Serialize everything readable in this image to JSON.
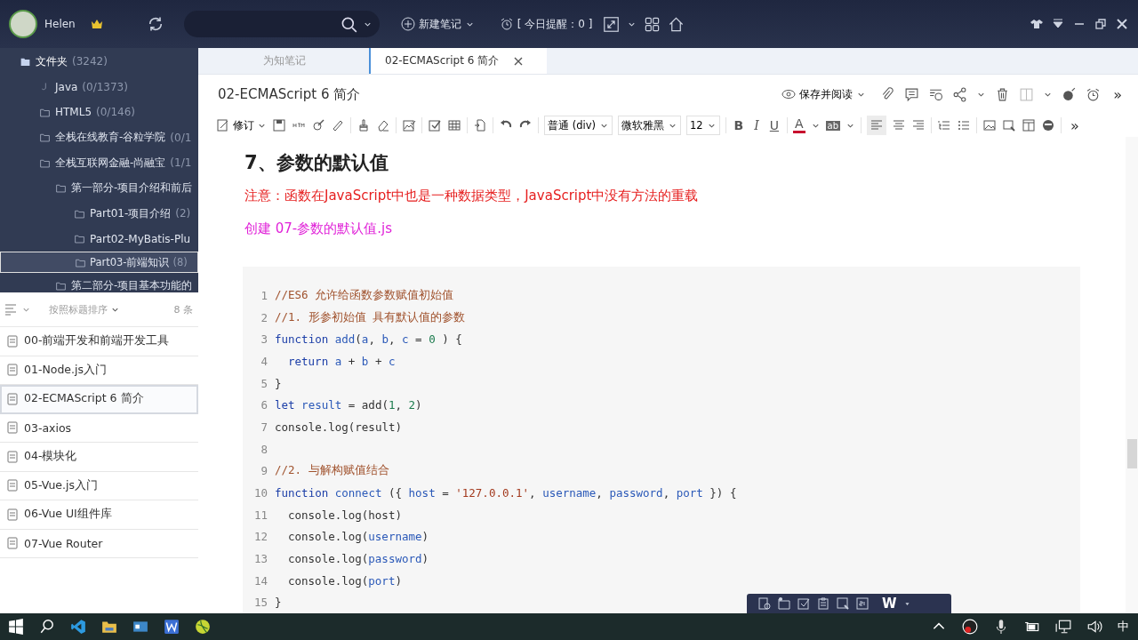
{
  "topbar": {
    "user": "Helen",
    "new_note": "新建笔记",
    "reminder": "[ 今日提醒：0 ]"
  },
  "folders": [
    {
      "name": "文件夹",
      "count": "(3242)",
      "kind": "root",
      "selected": false,
      "children": [
        {
          "name": "Java",
          "count": "(0/1373)",
          "kind": "java",
          "selected": false
        },
        {
          "name": "HTML5",
          "count": "(0/146)",
          "kind": "folder",
          "selected": false
        },
        {
          "name": "全栈在线教育-谷粒学院",
          "count": "(0/1",
          "kind": "folder",
          "selected": false
        },
        {
          "name": "全栈互联网金融-尚融宝",
          "count": "(1/1",
          "kind": "folder",
          "selected": false,
          "children": [
            {
              "name": "第一部分-项目介绍和前后",
              "kind": "folder",
              "selected": false,
              "children": [
                {
                  "name": "Part01-项目介绍",
                  "count": "(2)",
                  "kind": "folder",
                  "selected": false
                },
                {
                  "name": "Part02-MyBatis-Plu",
                  "kind": "folder",
                  "selected": false
                },
                {
                  "name": "Part03-前端知识",
                  "count": "(8)",
                  "kind": "folder",
                  "selected": true
                }
              ]
            },
            {
              "name": "第二部分-项目基本功能的",
              "kind": "folder",
              "selected": false
            }
          ]
        }
      ]
    }
  ],
  "notes_header": {
    "sort": "按照标题排序",
    "count": "8 条"
  },
  "notes": [
    {
      "title": "00-前端开发和前端开发工具",
      "selected": false
    },
    {
      "title": "01-Node.js入门",
      "selected": false
    },
    {
      "title": "02-ECMAScript 6 简介",
      "selected": true
    },
    {
      "title": "03-axios",
      "selected": false
    },
    {
      "title": "04-模块化",
      "selected": false
    },
    {
      "title": "05-Vue.js入门",
      "selected": false
    },
    {
      "title": "06-Vue UI组件库",
      "selected": false
    },
    {
      "title": "07-Vue Router",
      "selected": false
    }
  ],
  "tabs": [
    {
      "label": "为知笔记",
      "selected": false
    },
    {
      "label": "02-ECMAScript 6 简介",
      "selected": true
    }
  ],
  "note_title": "02-ECMAScript 6 简介",
  "save_read": "保存并阅读",
  "header_more": "»",
  "toolbar": {
    "revise": "修订",
    "paragraph": "普通 (div)",
    "font": "微软雅黑",
    "size": "12",
    "bold": "B",
    "italic": "I",
    "underline": "U",
    "font_color": "A",
    "highlight": "ab",
    "more": "»"
  },
  "content": {
    "heading": "7、参数的默认值",
    "note": "注意：函数在JavaScript中也是一种数据类型，JavaScript中没有方法的重载",
    "create": "创建 07-参数的默认值.js",
    "code": [
      {
        "num": "1",
        "indent": false,
        "tokens": [
          {
            "kind": "comment",
            "text": "//ES6 允许给函数参数赋值初始值"
          }
        ]
      },
      {
        "num": "2",
        "indent": false,
        "tokens": [
          {
            "kind": "comment",
            "text": "//1. 形参初始值 具有默认值的参数"
          }
        ]
      },
      {
        "num": "3",
        "indent": false,
        "tokens": [
          {
            "kind": "keyword",
            "text": "function"
          },
          {
            "kind": "name",
            "text": "add"
          },
          {
            "kind": "plain",
            "text": "("
          },
          {
            "kind": "name",
            "text": "a"
          },
          {
            "kind": "plain",
            "text": ","
          },
          {
            "kind": "name",
            "text": "b"
          },
          {
            "kind": "plain",
            "text": ","
          },
          {
            "kind": "name",
            "text": "c"
          },
          {
            "kind": "plain",
            "text": "="
          },
          {
            "kind": "number",
            "text": "0"
          },
          {
            "kind": "plain",
            "text": ") {"
          }
        ]
      },
      {
        "num": "4",
        "indent": true,
        "tokens": [
          {
            "kind": "keyword",
            "text": "return"
          },
          {
            "kind": "name",
            "text": "a"
          },
          {
            "kind": "plain",
            "text": "+"
          },
          {
            "kind": "name",
            "text": "b"
          },
          {
            "kind": "plain",
            "text": "+"
          },
          {
            "kind": "name",
            "text": "c"
          }
        ]
      },
      {
        "num": "5",
        "indent": false,
        "tokens": [
          {
            "kind": "plain",
            "text": "}"
          }
        ]
      },
      {
        "num": "6",
        "indent": false,
        "tokens": [
          {
            "kind": "keyword",
            "text": "let"
          },
          {
            "kind": "name",
            "text": "result"
          },
          {
            "kind": "plain",
            "text": "= add("
          },
          {
            "kind": "number",
            "text": "1"
          },
          {
            "kind": "plain",
            "text": ","
          },
          {
            "kind": "number",
            "text": "2"
          },
          {
            "kind": "plain",
            "text": ")"
          }
        ]
      },
      {
        "num": "7",
        "indent": false,
        "tokens": [
          {
            "kind": "plain",
            "text": "console.log(result)"
          }
        ]
      },
      {
        "num": "8"
      },
      {
        "num": "9",
        "indent": false,
        "tokens": [
          {
            "kind": "comment",
            "text": "//2. 与解构赋值结合"
          }
        ]
      },
      {
        "num": "10",
        "indent": false,
        "tokens": [
          {
            "kind": "keyword",
            "text": "function"
          },
          {
            "kind": "name",
            "text": "connect"
          },
          {
            "kind": "plain",
            "text": "({"
          },
          {
            "kind": "name",
            "text": "host"
          },
          {
            "kind": "plain",
            "text": "="
          },
          {
            "kind": "string",
            "text": "'127.0.0.1'"
          },
          {
            "kind": "plain",
            "text": ","
          },
          {
            "kind": "name",
            "text": "username"
          },
          {
            "kind": "plain",
            "text": ","
          },
          {
            "kind": "name",
            "text": "password"
          },
          {
            "kind": "plain",
            "text": ","
          },
          {
            "kind": "name",
            "text": "port"
          },
          {
            "kind": "plain",
            "text": "}) {"
          }
        ]
      },
      {
        "num": "11",
        "indent": true,
        "tokens": [
          {
            "kind": "plain",
            "text": "console.log(host)"
          }
        ]
      },
      {
        "num": "12",
        "indent": true,
        "tokens": [
          {
            "kind": "plain",
            "text": "console.log("
          },
          {
            "kind": "name",
            "text": "username"
          },
          {
            "kind": "plain",
            "text": ")"
          }
        ]
      },
      {
        "num": "13",
        "indent": true,
        "tokens": [
          {
            "kind": "plain",
            "text": "console.log("
          },
          {
            "kind": "name",
            "text": "password"
          },
          {
            "kind": "plain",
            "text": ")"
          }
        ]
      },
      {
        "num": "14",
        "indent": true,
        "tokens": [
          {
            "kind": "plain",
            "text": "console.log("
          },
          {
            "kind": "name",
            "text": "port"
          },
          {
            "kind": "plain",
            "text": ")"
          }
        ]
      },
      {
        "num": "15",
        "indent": false,
        "tokens": [
          {
            "kind": "plain",
            "text": "}"
          }
        ]
      }
    ]
  },
  "float_toolbar": {
    "word": "W"
  },
  "taskbar": {
    "ime": "中"
  }
}
